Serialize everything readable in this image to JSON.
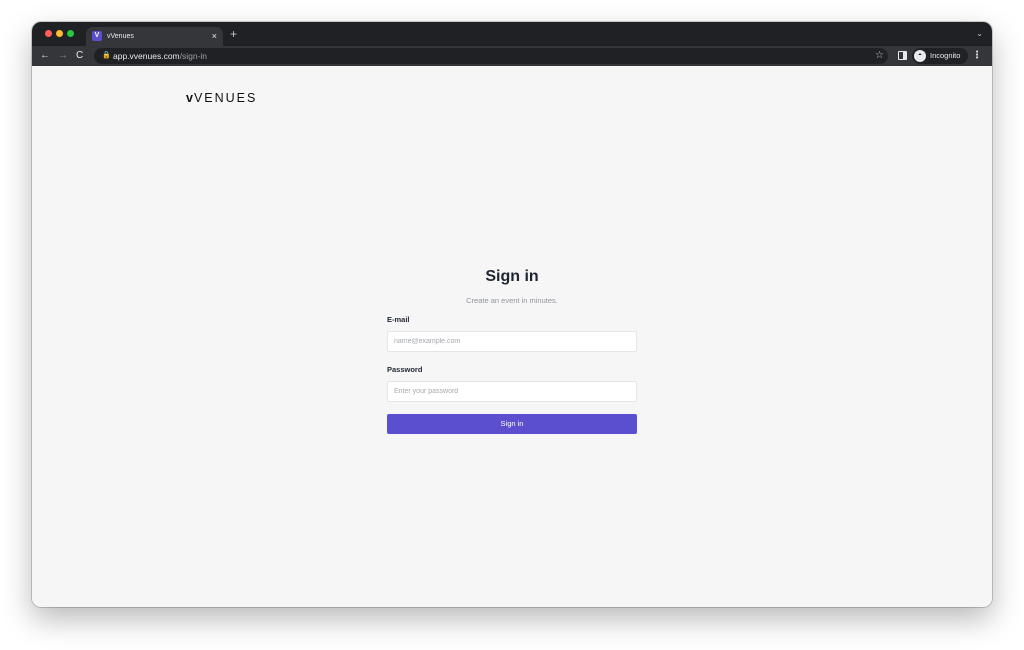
{
  "browser": {
    "tab": {
      "favicon": "V",
      "title": "vVenues",
      "close": "×"
    },
    "new_tab": "+",
    "tab_menu": "⌄",
    "nav": {
      "back": "←",
      "forward": "→",
      "reload": "C"
    },
    "address": {
      "host": "app.vvenues.com",
      "path": "/sign-in"
    },
    "incognito_label": "Incognito"
  },
  "page": {
    "logo": {
      "v": "v",
      "rest": "VENUES"
    },
    "title": "Sign in",
    "subtitle": "Create an event in minutes.",
    "email": {
      "label": "E-mail",
      "placeholder": "name@example.com",
      "value": ""
    },
    "password": {
      "label": "Password",
      "placeholder": "Enter your password",
      "value": ""
    },
    "submit_label": "Sign in"
  },
  "colors": {
    "accent": "#5a4fcf",
    "page_background": "#f6f6f6",
    "heading": "#1d2533",
    "browser_dark": "#202124"
  }
}
